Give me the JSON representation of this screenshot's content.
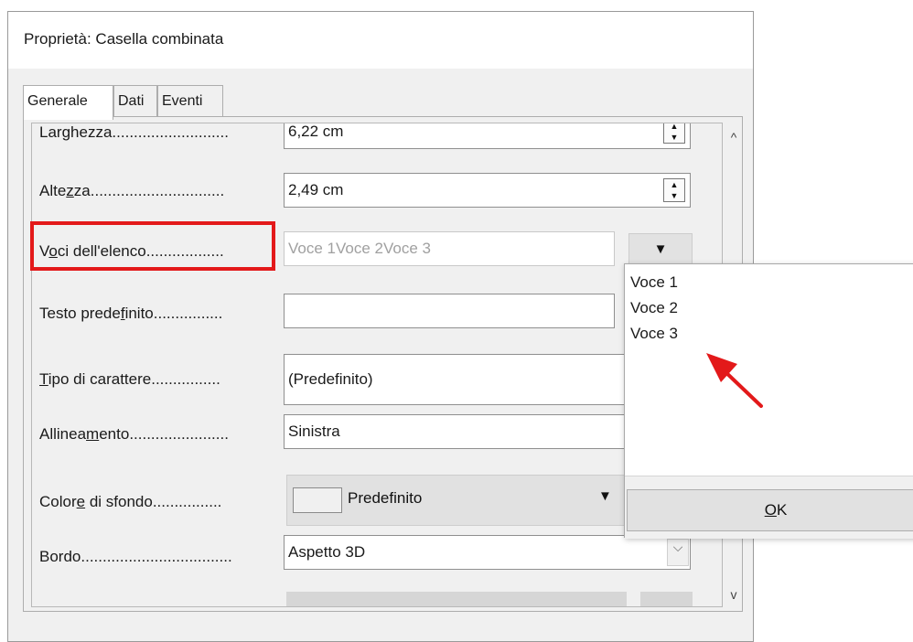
{
  "dialog": {
    "title": "Proprietà: Casella combinata",
    "close_glyph": "✕"
  },
  "tabs": [
    {
      "label": "Generale"
    },
    {
      "label": "Dati"
    },
    {
      "label": "Eventi"
    }
  ],
  "properties": {
    "larghezza": {
      "label_pre": "Lar",
      "label_u": "g",
      "label_post": "hezza",
      "dots": "...........................",
      "value": "6,22 cm"
    },
    "altezza": {
      "label_pre": "Alte",
      "label_u": "z",
      "label_post": "za",
      "dots": "...............................",
      "value": "2,49 cm"
    },
    "voci": {
      "label_pre": "V",
      "label_u": "o",
      "label_post": "ci dell'elenco",
      "dots": "..................",
      "value": "Voce 1Voce 2Voce 3"
    },
    "testo": {
      "label_pre": "Testo prede",
      "label_u": "f",
      "label_post": "inito",
      "dots": "................",
      "value": ""
    },
    "tipo": {
      "label_pre": "",
      "label_u": "T",
      "label_post": "ipo di carattere",
      "dots": "................",
      "value": "(Predefinito)"
    },
    "allineamento": {
      "label_pre": "Allinea",
      "label_u": "m",
      "label_post": "ento",
      "dots": ".......................",
      "value": "Sinistra"
    },
    "colore": {
      "label_pre": "Color",
      "label_u": "e",
      "label_post": " di sfondo",
      "dots": "................",
      "value": "Predefinito"
    },
    "bordo": {
      "label_pre": "Bordo",
      "label_u": "",
      "label_post": "",
      "dots": "...................................",
      "value": "Aspetto 3D"
    }
  },
  "dropdown": {
    "items": [
      "Voce 1",
      "Voce 2",
      "Voce 3"
    ],
    "ok_u": "O",
    "ok_rest": "K"
  },
  "glyphs": {
    "spin_up": "▲",
    "spin_down": "▼",
    "dropdown": "▼",
    "scroll_up": "^",
    "scroll_down": "v",
    "combo_chevron": "⌵"
  },
  "colors": {
    "highlight": "#e3191a",
    "annotation_arrow": "#e3191a"
  }
}
